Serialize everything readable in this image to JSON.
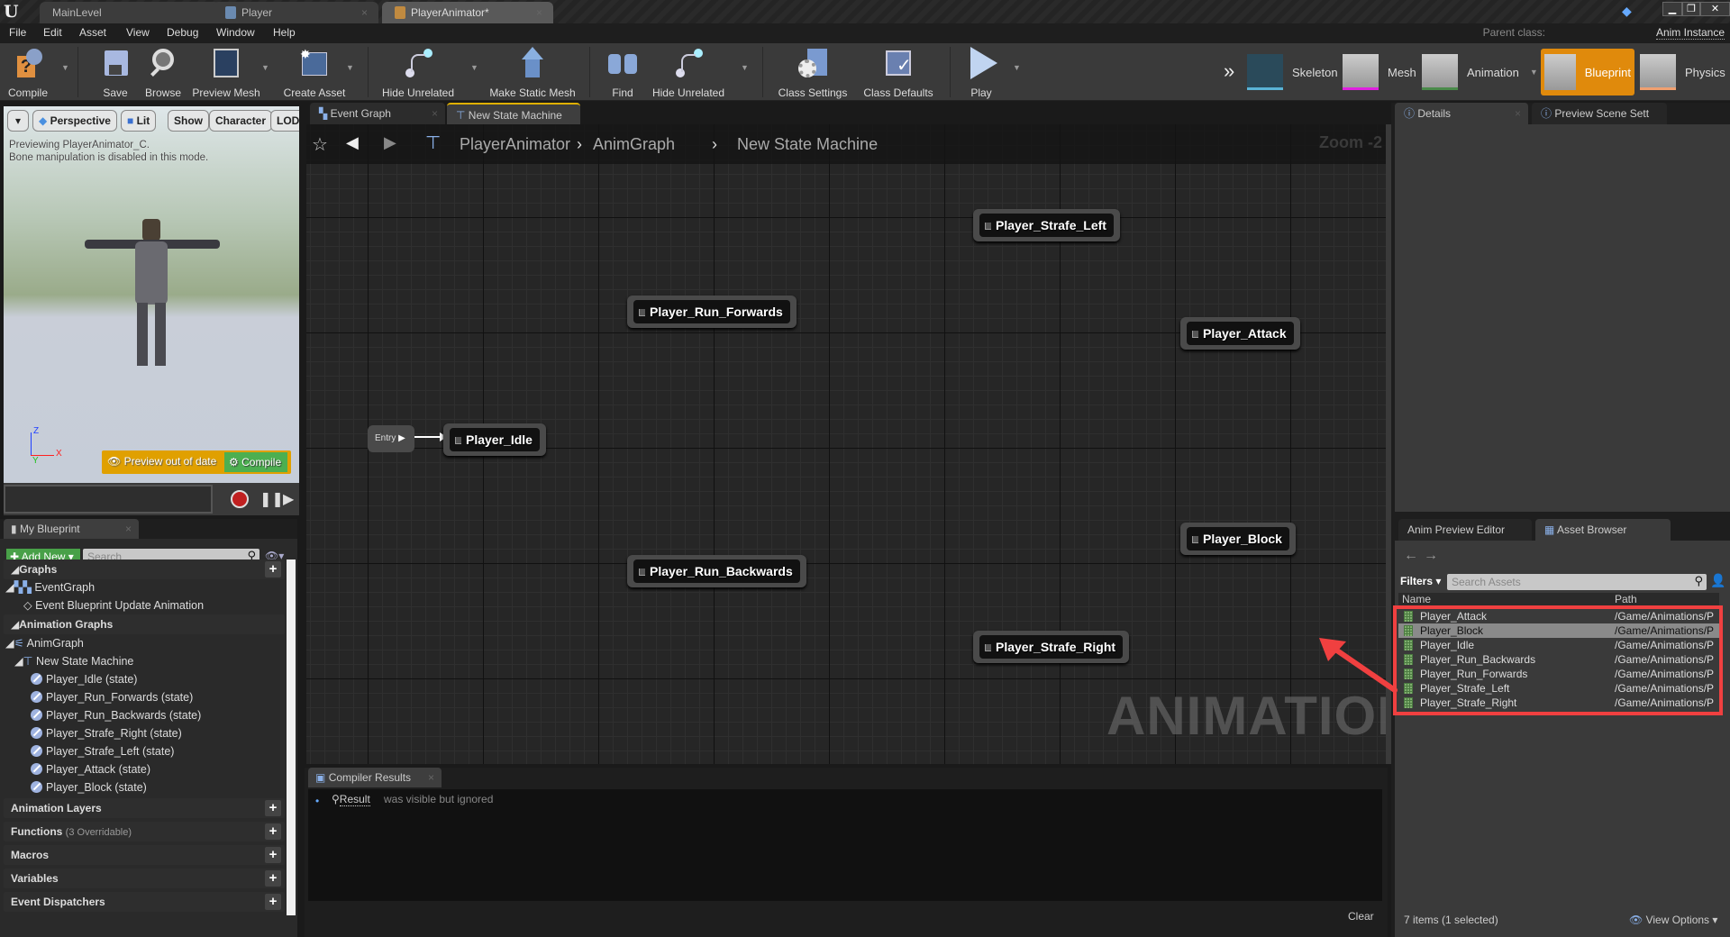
{
  "title_bar": {
    "tabs": [
      {
        "label": "MainLevel",
        "active": false
      },
      {
        "label": "Player",
        "active": false
      },
      {
        "label": "PlayerAnimator*",
        "active": true
      }
    ],
    "window_controls": [
      "minimize",
      "restore",
      "close"
    ]
  },
  "menu": {
    "items": [
      "File",
      "Edit",
      "Asset",
      "View",
      "Debug",
      "Window",
      "Help"
    ],
    "parent_class_label": "Parent class:",
    "parent_class_value": "Anim Instance"
  },
  "toolbar": {
    "buttons": [
      {
        "label": "Compile",
        "icon": "compile-icon"
      },
      {
        "label": "Save",
        "icon": "save-icon"
      },
      {
        "label": "Browse",
        "icon": "browse-icon"
      },
      {
        "label": "Preview Mesh",
        "icon": "preview-mesh-icon"
      },
      {
        "label": "Create Asset",
        "icon": "create-asset-icon"
      },
      {
        "label": "Hide Unrelated",
        "icon": "hide-unrelated-icon"
      },
      {
        "label": "Make Static Mesh",
        "icon": "make-static-mesh-icon"
      },
      {
        "label": "Find",
        "icon": "find-icon"
      },
      {
        "label": "Hide Unrelated",
        "icon": "hide-unrelated-icon"
      },
      {
        "label": "Class Settings",
        "icon": "class-settings-icon"
      },
      {
        "label": "Class Defaults",
        "icon": "class-defaults-icon"
      },
      {
        "label": "Play",
        "icon": "play-icon"
      }
    ],
    "modes": [
      {
        "label": "Skeleton",
        "color": "#5ab4d6"
      },
      {
        "label": "Mesh",
        "color": "#e020e0"
      },
      {
        "label": "Animation",
        "color": "#4a8a4a"
      },
      {
        "label": "Blueprint",
        "color": "#e08a0c",
        "active": true
      },
      {
        "label": "Physics",
        "color": "#f0a070"
      }
    ]
  },
  "viewport": {
    "buttons": [
      "Perspective",
      "Lit",
      "Show",
      "Character",
      "LOD"
    ],
    "info_line1": "Previewing PlayerAnimator_C.",
    "info_line2": "Bone manipulation is disabled in this mode.",
    "preview_status": "Preview out of date",
    "compile_label": "Compile",
    "axes": {
      "z": "Z",
      "x": "X",
      "y": "Y"
    }
  },
  "my_blueprint": {
    "tab_label": "My Blueprint",
    "add_new_label": "Add New",
    "search_placeholder": "Search",
    "sections": {
      "graphs": "Graphs",
      "event_graph": "EventGraph",
      "event_update": "Event Blueprint Update Animation",
      "animation_graphs": "Animation Graphs",
      "anim_graph": "AnimGraph",
      "state_machine": "New State Machine",
      "states": [
        "Player_Idle (state)",
        "Player_Run_Forwards (state)",
        "Player_Run_Backwards (state)",
        "Player_Strafe_Right (state)",
        "Player_Strafe_Left (state)",
        "Player_Attack (state)",
        "Player_Block (state)"
      ],
      "animation_layers": "Animation Layers",
      "functions": "Functions",
      "functions_note": "(3 Overridable)",
      "macros": "Macros",
      "variables": "Variables",
      "event_dispatchers": "Event Dispatchers"
    }
  },
  "graph": {
    "tabs": [
      {
        "label": "Event Graph",
        "active": false
      },
      {
        "label": "New State Machine",
        "active": true
      }
    ],
    "breadcrumb": [
      "PlayerAnimator",
      "AnimGraph",
      "New State Machine"
    ],
    "zoom_label": "Zoom -2",
    "entry_label": "Entry",
    "nodes": {
      "idle": "Player_Idle",
      "run_forwards": "Player_Run_Forwards",
      "strafe_left": "Player_Strafe_Left",
      "attack": "Player_Attack",
      "block": "Player_Block",
      "run_backwards": "Player_Run_Backwards",
      "strafe_right": "Player_Strafe_Right"
    },
    "watermark": "ANIMATION"
  },
  "compiler": {
    "tab_label": "Compiler Results",
    "result_link": "Result",
    "result_text": "was visible but ignored",
    "clear_label": "Clear"
  },
  "right_panel": {
    "tabs_top": [
      "Details",
      "Preview Scene Sett"
    ],
    "tabs_bottom": [
      "Anim Preview Editor",
      "Asset Browser"
    ],
    "filters_label": "Filters",
    "search_placeholder": "Search Assets",
    "col_name": "Name",
    "col_path": "Path",
    "assets": [
      {
        "name": "Player_Attack",
        "path": "/Game/Animations/P",
        "selected": false
      },
      {
        "name": "Player_Block",
        "path": "/Game/Animations/P",
        "selected": true
      },
      {
        "name": "Player_Idle",
        "path": "/Game/Animations/P",
        "selected": false
      },
      {
        "name": "Player_Run_Backwards",
        "path": "/Game/Animations/P",
        "selected": false
      },
      {
        "name": "Player_Run_Forwards",
        "path": "/Game/Animations/P",
        "selected": false
      },
      {
        "name": "Player_Strafe_Left",
        "path": "/Game/Animations/P",
        "selected": false
      },
      {
        "name": "Player_Strafe_Right",
        "path": "/Game/Animations/P",
        "selected": false
      }
    ],
    "item_count": "7 items (1 selected)",
    "view_options": "View Options"
  },
  "annotation": {
    "color": "#f04040"
  }
}
